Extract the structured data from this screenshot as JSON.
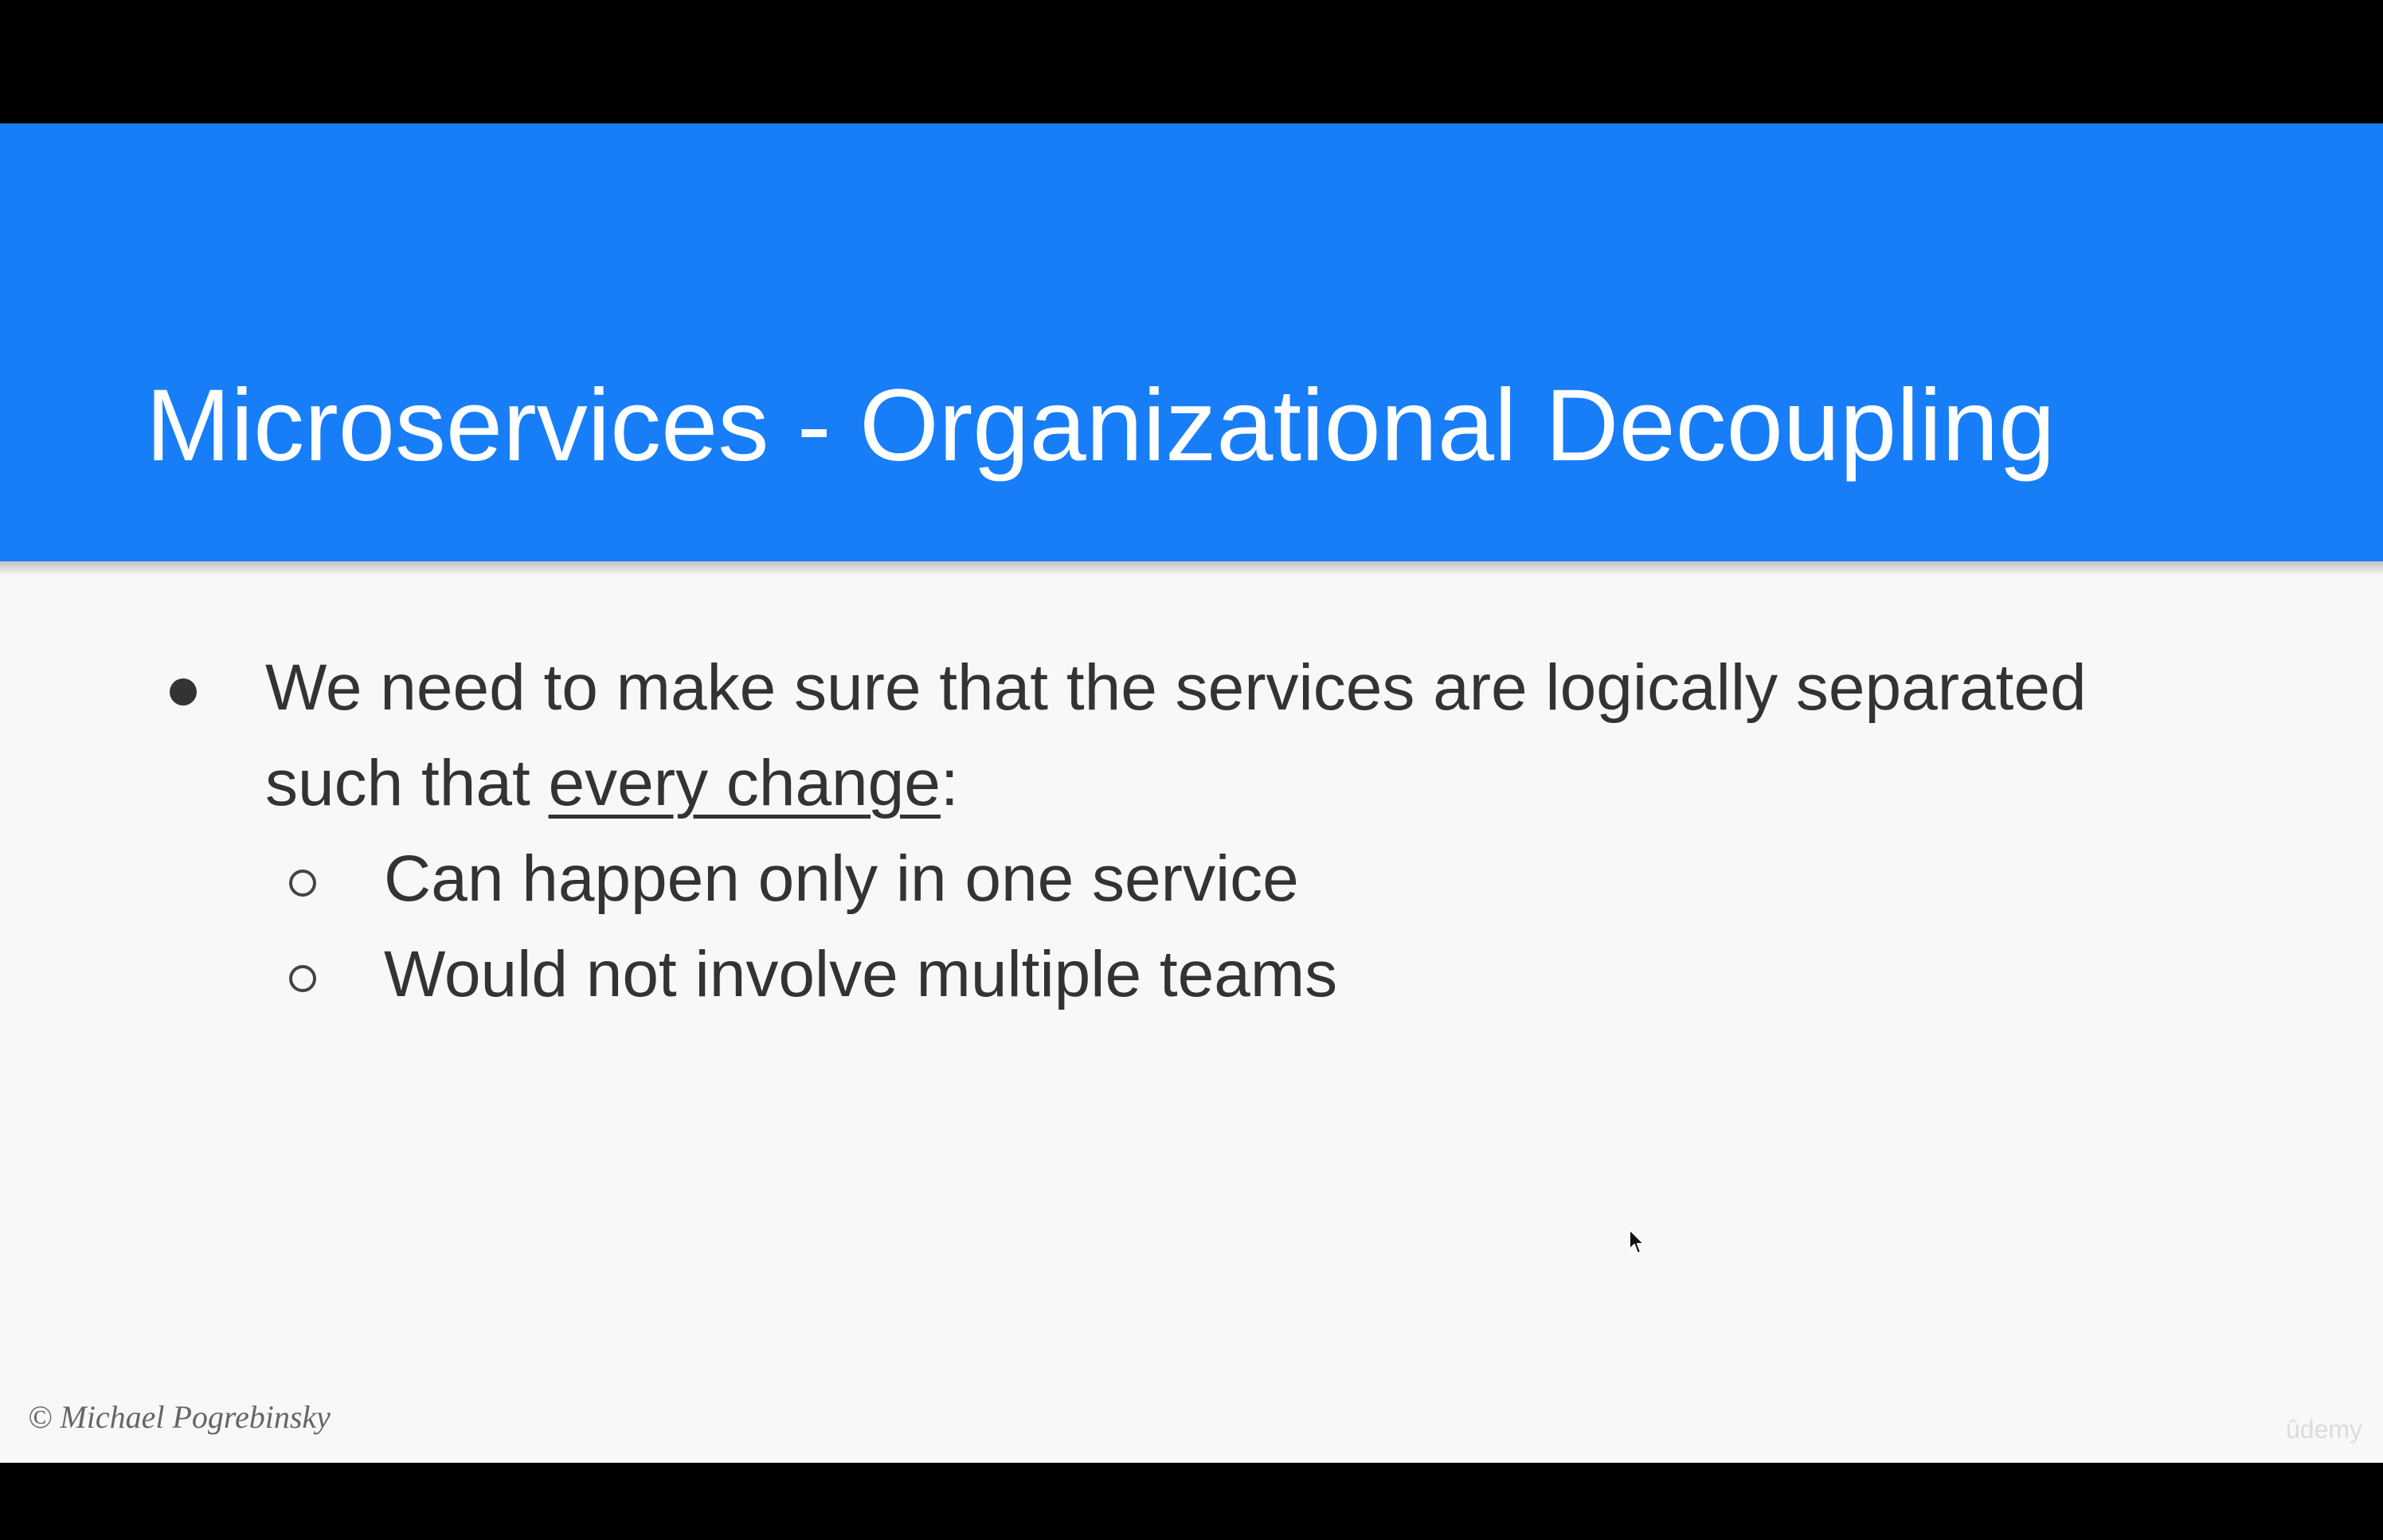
{
  "slide": {
    "title": "Microservices - Organizational Decoupling",
    "bullet": {
      "line1": "We need to make sure that the services are logically separated",
      "line2_prefix": "such that ",
      "line2_emphasis": "every change",
      "line2_suffix": ":",
      "sub_items": [
        "Can happen only in one service",
        "Would not involve multiple teams"
      ]
    },
    "copyright": "© Michael Pogrebinsky",
    "watermark": "ûdemy"
  },
  "colors": {
    "header": "#177ef8",
    "body_background": "#f8f8f8",
    "text": "#333333",
    "letterbox": "#000000"
  },
  "icons": {
    "bullet": "filled-circle-bullet",
    "sub_bullet": "hollow-circle-bullet",
    "cursor": "mouse-pointer-icon"
  }
}
